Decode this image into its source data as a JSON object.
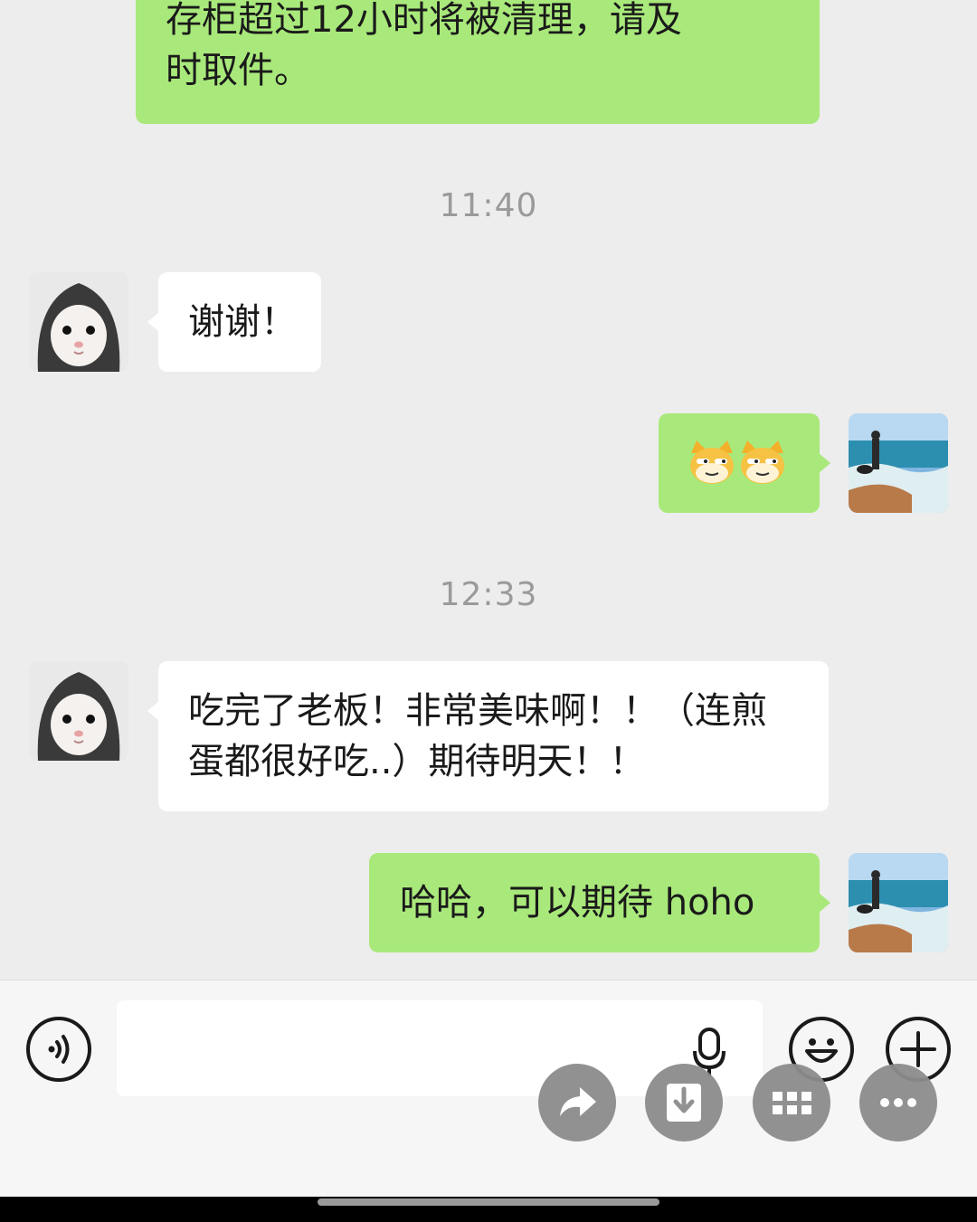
{
  "messages": [
    {
      "id": "m1",
      "side": "right",
      "text": "存柜超过12小时将被清理，请及\n时取件。"
    },
    {
      "id": "ts1",
      "type": "timestamp",
      "text": "11:40"
    },
    {
      "id": "m2",
      "side": "left",
      "text": "谢谢！"
    },
    {
      "id": "m3",
      "side": "right",
      "type": "emoji",
      "emoji": [
        "doge-cat-emoji",
        "doge-cat-emoji"
      ]
    },
    {
      "id": "ts2",
      "type": "timestamp",
      "text": "12:33"
    },
    {
      "id": "m4",
      "side": "left",
      "text": "吃完了老板！非常美味啊！！（连煎\n蛋都很好吃..）期待明天！！"
    },
    {
      "id": "m5",
      "side": "right",
      "text": "哈哈，可以期待 hoho"
    }
  ],
  "contact": {
    "avatar_icon": "hooded-hamster-avatar"
  },
  "me": {
    "avatar_icon": "beach-photo-avatar"
  },
  "input_bar": {
    "voice_icon": "voice-toggle-icon",
    "input_value": "",
    "mic_icon": "microphone-icon",
    "emoji_icon": "smiley-icon",
    "plus_icon": "plus-icon"
  },
  "floating_actions": [
    "share-icon",
    "save-download-icon",
    "grid-apps-icon",
    "more-icon"
  ],
  "colors": {
    "background": "#ededed",
    "sent_bubble": "#a9e97b",
    "received_bubble": "#ffffff",
    "timestamp": "#9a9a9a",
    "fab": "#8c8c8c"
  }
}
